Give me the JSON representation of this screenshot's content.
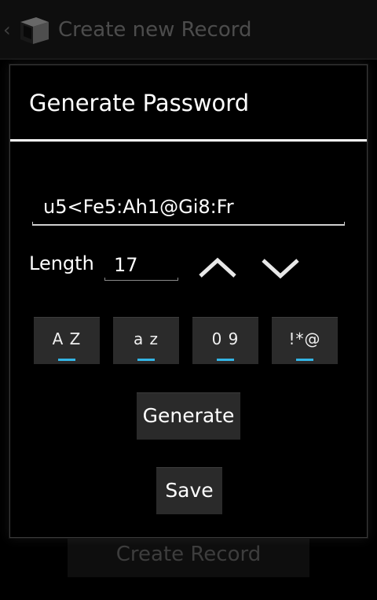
{
  "actionbar": {
    "back_icon": "chevron-left-icon",
    "app_icon": "cube-icon",
    "title": "Create new Record"
  },
  "background": {
    "create_record_label": "Create Record"
  },
  "dialog": {
    "title": "Generate Password",
    "password_value": "u5<Fe5:Ah1@Gi8:Fr",
    "length_label": "Length",
    "length_value": "17",
    "increment_icon": "chevron-up-icon",
    "decrement_icon": "chevron-down-icon",
    "toggles": [
      {
        "label": "A Z",
        "checked": true
      },
      {
        "label": "a z",
        "checked": true
      },
      {
        "label": "0 9",
        "checked": true
      },
      {
        "label": "!*@",
        "checked": true
      }
    ],
    "generate_label": "Generate",
    "save_label": "Save"
  },
  "colors": {
    "accent": "#33b5e5",
    "background": "#000000",
    "button": "#2a2a2a"
  }
}
